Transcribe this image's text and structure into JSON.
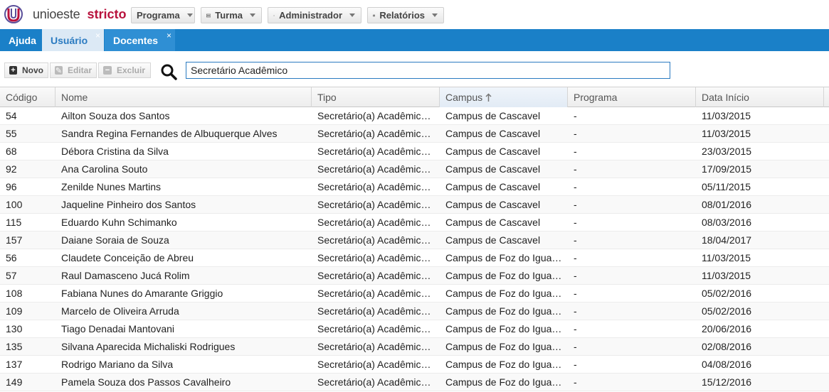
{
  "header": {
    "logo_text": "unioeste",
    "logo_strong": "stricto",
    "menus": [
      {
        "label": "Programa",
        "icon": "none"
      },
      {
        "label": "Turma",
        "icon": "keyboard-icon"
      },
      {
        "label": "Administrador",
        "icon": "gear-icon"
      },
      {
        "label": "Relatórios",
        "icon": "printer-icon"
      }
    ]
  },
  "tabs": [
    {
      "label": "Ajuda",
      "closable": false,
      "active": false
    },
    {
      "label": "Usuário",
      "closable": true,
      "active": true
    },
    {
      "label": "Docentes",
      "closable": true,
      "active": false
    }
  ],
  "tab_close_glyph": "×",
  "toolbar": {
    "new_label": "Novo",
    "edit_label": "Editar",
    "delete_label": "Excluir"
  },
  "search": {
    "value": "Secretário Acadêmico"
  },
  "table": {
    "columns": [
      "Código",
      "Nome",
      "Tipo",
      "Campus",
      "Programa",
      "Data Início"
    ],
    "sorted_column": "Campus",
    "sort_direction": "ascending",
    "rows": [
      [
        "54",
        "Ailton Souza dos Santos",
        "Secretário(a) Acadêmico(a)",
        "Campus de Cascavel",
        "-",
        "11/03/2015"
      ],
      [
        "55",
        "Sandra Regina Fernandes de Albuquerque Alves",
        "Secretário(a) Acadêmico(a)",
        "Campus de Cascavel",
        "-",
        "11/03/2015"
      ],
      [
        "68",
        "Débora Cristina da Silva",
        "Secretário(a) Acadêmico(a)",
        "Campus de Cascavel",
        "-",
        "23/03/2015"
      ],
      [
        "92",
        "Ana Carolina Souto",
        "Secretário(a) Acadêmico(a)",
        "Campus de Cascavel",
        "-",
        "17/09/2015"
      ],
      [
        "96",
        "Zenilde Nunes Martins",
        "Secretário(a) Acadêmico(a)",
        "Campus de Cascavel",
        "-",
        "05/11/2015"
      ],
      [
        "100",
        "Jaqueline Pinheiro dos Santos",
        "Secretário(a) Acadêmico(a)",
        "Campus de Cascavel",
        "-",
        "08/01/2016"
      ],
      [
        "115",
        "Eduardo Kuhn Schimanko",
        "Secretário(a) Acadêmico(a)",
        "Campus de Cascavel",
        "-",
        "08/03/2016"
      ],
      [
        "157",
        "Daiane Soraia de Souza",
        "Secretário(a) Acadêmico(a)",
        "Campus de Cascavel",
        "-",
        "18/04/2017"
      ],
      [
        "56",
        "Claudete Conceição de Abreu",
        "Secretário(a) Acadêmico(a)",
        "Campus de Foz do Iguaçu",
        "-",
        "11/03/2015"
      ],
      [
        "57",
        "Raul Damasceno Jucá Rolim",
        "Secretário(a) Acadêmico(a)",
        "Campus de Foz do Iguaçu",
        "-",
        "11/03/2015"
      ],
      [
        "108",
        "Fabiana Nunes do Amarante Griggio",
        "Secretário(a) Acadêmico(a)",
        "Campus de Foz do Iguaçu",
        "-",
        "05/02/2016"
      ],
      [
        "109",
        "Marcelo de Oliveira Arruda",
        "Secretário(a) Acadêmico(a)",
        "Campus de Foz do Iguaçu",
        "-",
        "05/02/2016"
      ],
      [
        "130",
        "Tiago Denadai Mantovani",
        "Secretário(a) Acadêmico(a)",
        "Campus de Foz do Iguaçu",
        "-",
        "20/06/2016"
      ],
      [
        "135",
        "Silvana Aparecida Michaliski Rodrigues",
        "Secretário(a) Acadêmico(a)",
        "Campus de Foz do Iguaçu",
        "-",
        "02/08/2016"
      ],
      [
        "137",
        "Rodrigo Mariano da Silva",
        "Secretário(a) Acadêmico(a)",
        "Campus de Foz do Iguaçu",
        "-",
        "04/08/2016"
      ],
      [
        "149",
        "Pamela Souza dos Passos Cavalheiro",
        "Secretário(a) Acadêmico(a)",
        "Campus de Foz do Iguaçu",
        "-",
        "15/12/2016"
      ]
    ]
  },
  "colors": {
    "brand": "#b8123d",
    "tabbar": "#1a80c8",
    "search_border": "#2b7bc1"
  }
}
